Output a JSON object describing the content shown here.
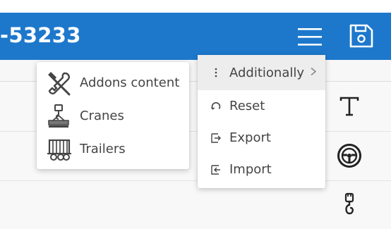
{
  "header": {
    "title": "-53233",
    "menu_icon": "hamburger-icon",
    "save_icon": "save-icon",
    "color": "#1d78cc"
  },
  "side_icons": [
    "text-icon",
    "steering-wheel-icon",
    "crane-hook-icon"
  ],
  "submenu": {
    "items": [
      {
        "label": "Addons content",
        "icon": "tools-icon"
      },
      {
        "label": "Cranes",
        "icon": "crane-icon"
      },
      {
        "label": "Trailers",
        "icon": "trailer-icon"
      }
    ]
  },
  "menu": {
    "items": [
      {
        "label": "Additionally",
        "icon": "more-vertical-icon",
        "has_submenu": true,
        "active": true
      },
      {
        "label": "Reset",
        "icon": "reset-icon"
      },
      {
        "label": "Export",
        "icon": "export-icon"
      },
      {
        "label": "Import",
        "icon": "import-icon"
      }
    ]
  }
}
